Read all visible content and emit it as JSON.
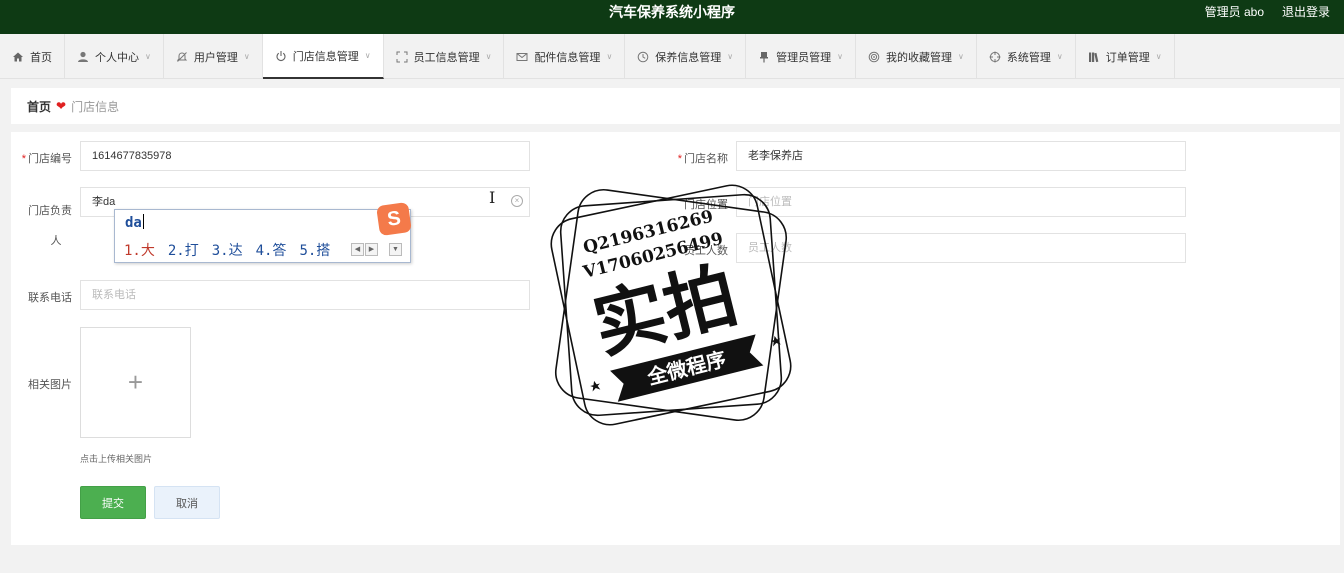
{
  "topbar": {
    "title": "汽车保养系统小程序",
    "user": "管理员 abo",
    "logout": "退出登录"
  },
  "menu": [
    {
      "label": "首页",
      "icon": "home-icon",
      "active": false
    },
    {
      "label": "个人中心",
      "icon": "user-icon",
      "active": false
    },
    {
      "label": "用户管理",
      "icon": "bell-off-icon",
      "active": false
    },
    {
      "label": "门店信息管理",
      "icon": "power-icon",
      "active": true
    },
    {
      "label": "员工信息管理",
      "icon": "expand-icon",
      "active": false
    },
    {
      "label": "配件信息管理",
      "icon": "mail-icon",
      "active": false
    },
    {
      "label": "保养信息管理",
      "icon": "clock-icon",
      "active": false
    },
    {
      "label": "管理员管理",
      "icon": "pin-icon",
      "active": false
    },
    {
      "label": "我的收藏管理",
      "icon": "target-icon",
      "active": false
    },
    {
      "label": "系统管理",
      "icon": "crosshair-icon",
      "active": false
    },
    {
      "label": "订单管理",
      "icon": "books-icon",
      "active": false
    }
  ],
  "breadcrumb": {
    "home": "首页",
    "current": "门店信息"
  },
  "form": {
    "store_no": {
      "label": "门店编号",
      "value": "1614677835978"
    },
    "store_name": {
      "label": "门店名称",
      "value": "老李保养店"
    },
    "manager": {
      "label_line1": "门店负责",
      "label_line2": "人",
      "value": "李da"
    },
    "location": {
      "label": "门店位置",
      "placeholder": "门店位置"
    },
    "staff": {
      "label": "员工人数",
      "placeholder": "员工人数"
    },
    "phone": {
      "label": "联系电话",
      "placeholder": "联系电话"
    },
    "images": {
      "label": "相关图片",
      "hint": "点击上传相关图片"
    },
    "submit": "提交",
    "cancel": "取消"
  },
  "ime": {
    "composition": "da",
    "candidates": [
      "1.大",
      "2.打",
      "3.达",
      "4.答",
      "5.搭"
    ],
    "logo": "S"
  },
  "watermark": {
    "line1": "Q2196316269",
    "line2": "V17060256499",
    "main": "实拍",
    "ribbon": "全微程序"
  }
}
